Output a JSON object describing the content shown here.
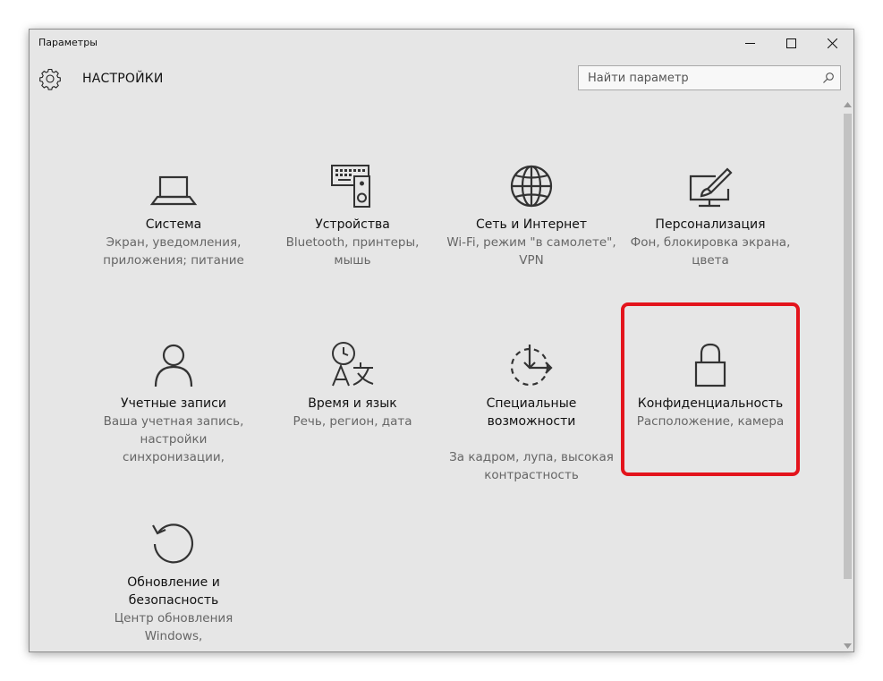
{
  "window": {
    "title": "Параметры"
  },
  "header": {
    "title": "НАСТРОЙКИ",
    "icon": "gear-icon"
  },
  "search": {
    "placeholder": "Найти параметр",
    "value": ""
  },
  "tiles": [
    {
      "name": "Система",
      "desc": "Экран, уведомления, приложения; питание",
      "icon": "laptop-icon"
    },
    {
      "name": "Устройства",
      "desc": "Bluetooth, принтеры, мышь",
      "icon": "devices-icon"
    },
    {
      "name": "Сеть и Интернет",
      "desc": "Wi-Fi, режим \"в самолете\", VPN",
      "icon": "globe-icon"
    },
    {
      "name": "Персонализация",
      "desc": "Фон, блокировка экрана, цвета",
      "icon": "paint-icon"
    },
    {
      "name": "Учетные записи",
      "desc": "Ваша учетная запись, настройки синхронизации,",
      "icon": "person-icon"
    },
    {
      "name": "Время и язык",
      "desc": "Речь, регион, дата",
      "icon": "time-language-icon"
    },
    {
      "name": "Специальные возможности",
      "desc": "За кадром, лупа, высокая контрастность",
      "icon": "accessibility-icon"
    },
    {
      "name": "Конфиденциальность",
      "desc": "Расположение, камера",
      "icon": "lock-icon"
    },
    {
      "name": "Обновление и безопасность",
      "desc": "Центр обновления Windows,",
      "icon": "update-icon"
    }
  ],
  "colors": {
    "background": "#e6e6e6",
    "highlight": "#e3141c",
    "text": "#111111",
    "subtext": "#666666"
  }
}
